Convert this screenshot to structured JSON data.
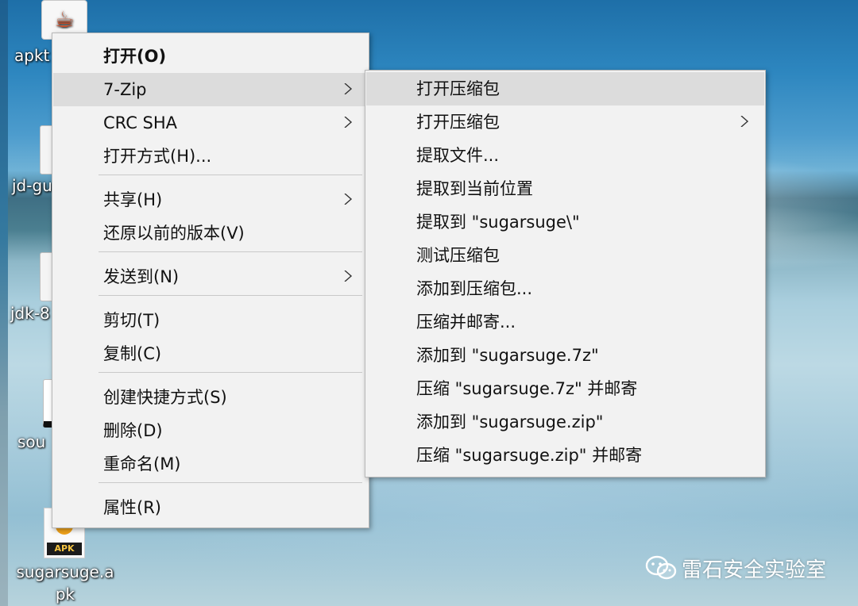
{
  "desktop": {
    "icons": [
      {
        "label": "apkt"
      },
      {
        "label": "jd-gu"
      },
      {
        "label": "jdk-8"
      },
      {
        "label": "sou"
      },
      {
        "label": "sugarsuge.a\npk",
        "line1": "sugarsuge.a",
        "line2": "pk"
      }
    ],
    "apk_icon_tag": "APK"
  },
  "context_menu": {
    "items": [
      {
        "label": "打开(O)",
        "bold": true
      },
      {
        "label": "7-Zip",
        "submenu": true,
        "highlighted": true
      },
      {
        "label": "CRC SHA",
        "submenu": true
      },
      {
        "label": "打开方式(H)..."
      },
      {
        "label": "共享(H)",
        "submenu": true
      },
      {
        "label": "还原以前的版本(V)"
      },
      {
        "label": "发送到(N)",
        "submenu": true
      },
      {
        "label": "剪切(T)"
      },
      {
        "label": "复制(C)"
      },
      {
        "label": "创建快捷方式(S)"
      },
      {
        "label": "删除(D)"
      },
      {
        "label": "重命名(M)"
      },
      {
        "label": "属性(R)"
      }
    ]
  },
  "submenu_7zip": {
    "items": [
      {
        "label": "打开压缩包",
        "highlighted": true
      },
      {
        "label": "打开压缩包",
        "submenu": true
      },
      {
        "label": "提取文件..."
      },
      {
        "label": "提取到当前位置"
      },
      {
        "label": "提取到 \"sugarsuge\\\""
      },
      {
        "label": "测试压缩包"
      },
      {
        "label": "添加到压缩包..."
      },
      {
        "label": "压缩并邮寄..."
      },
      {
        "label": "添加到 \"sugarsuge.7z\""
      },
      {
        "label": "压缩 \"sugarsuge.7z\" 并邮寄"
      },
      {
        "label": "添加到 \"sugarsuge.zip\""
      },
      {
        "label": "压缩 \"sugarsuge.zip\" 并邮寄"
      }
    ]
  },
  "watermark": {
    "text": "雷石安全实验室"
  },
  "colors": {
    "menu_bg": "#f2f2f2",
    "highlight": "#dcdcdc",
    "separator": "#c9c9c9"
  }
}
